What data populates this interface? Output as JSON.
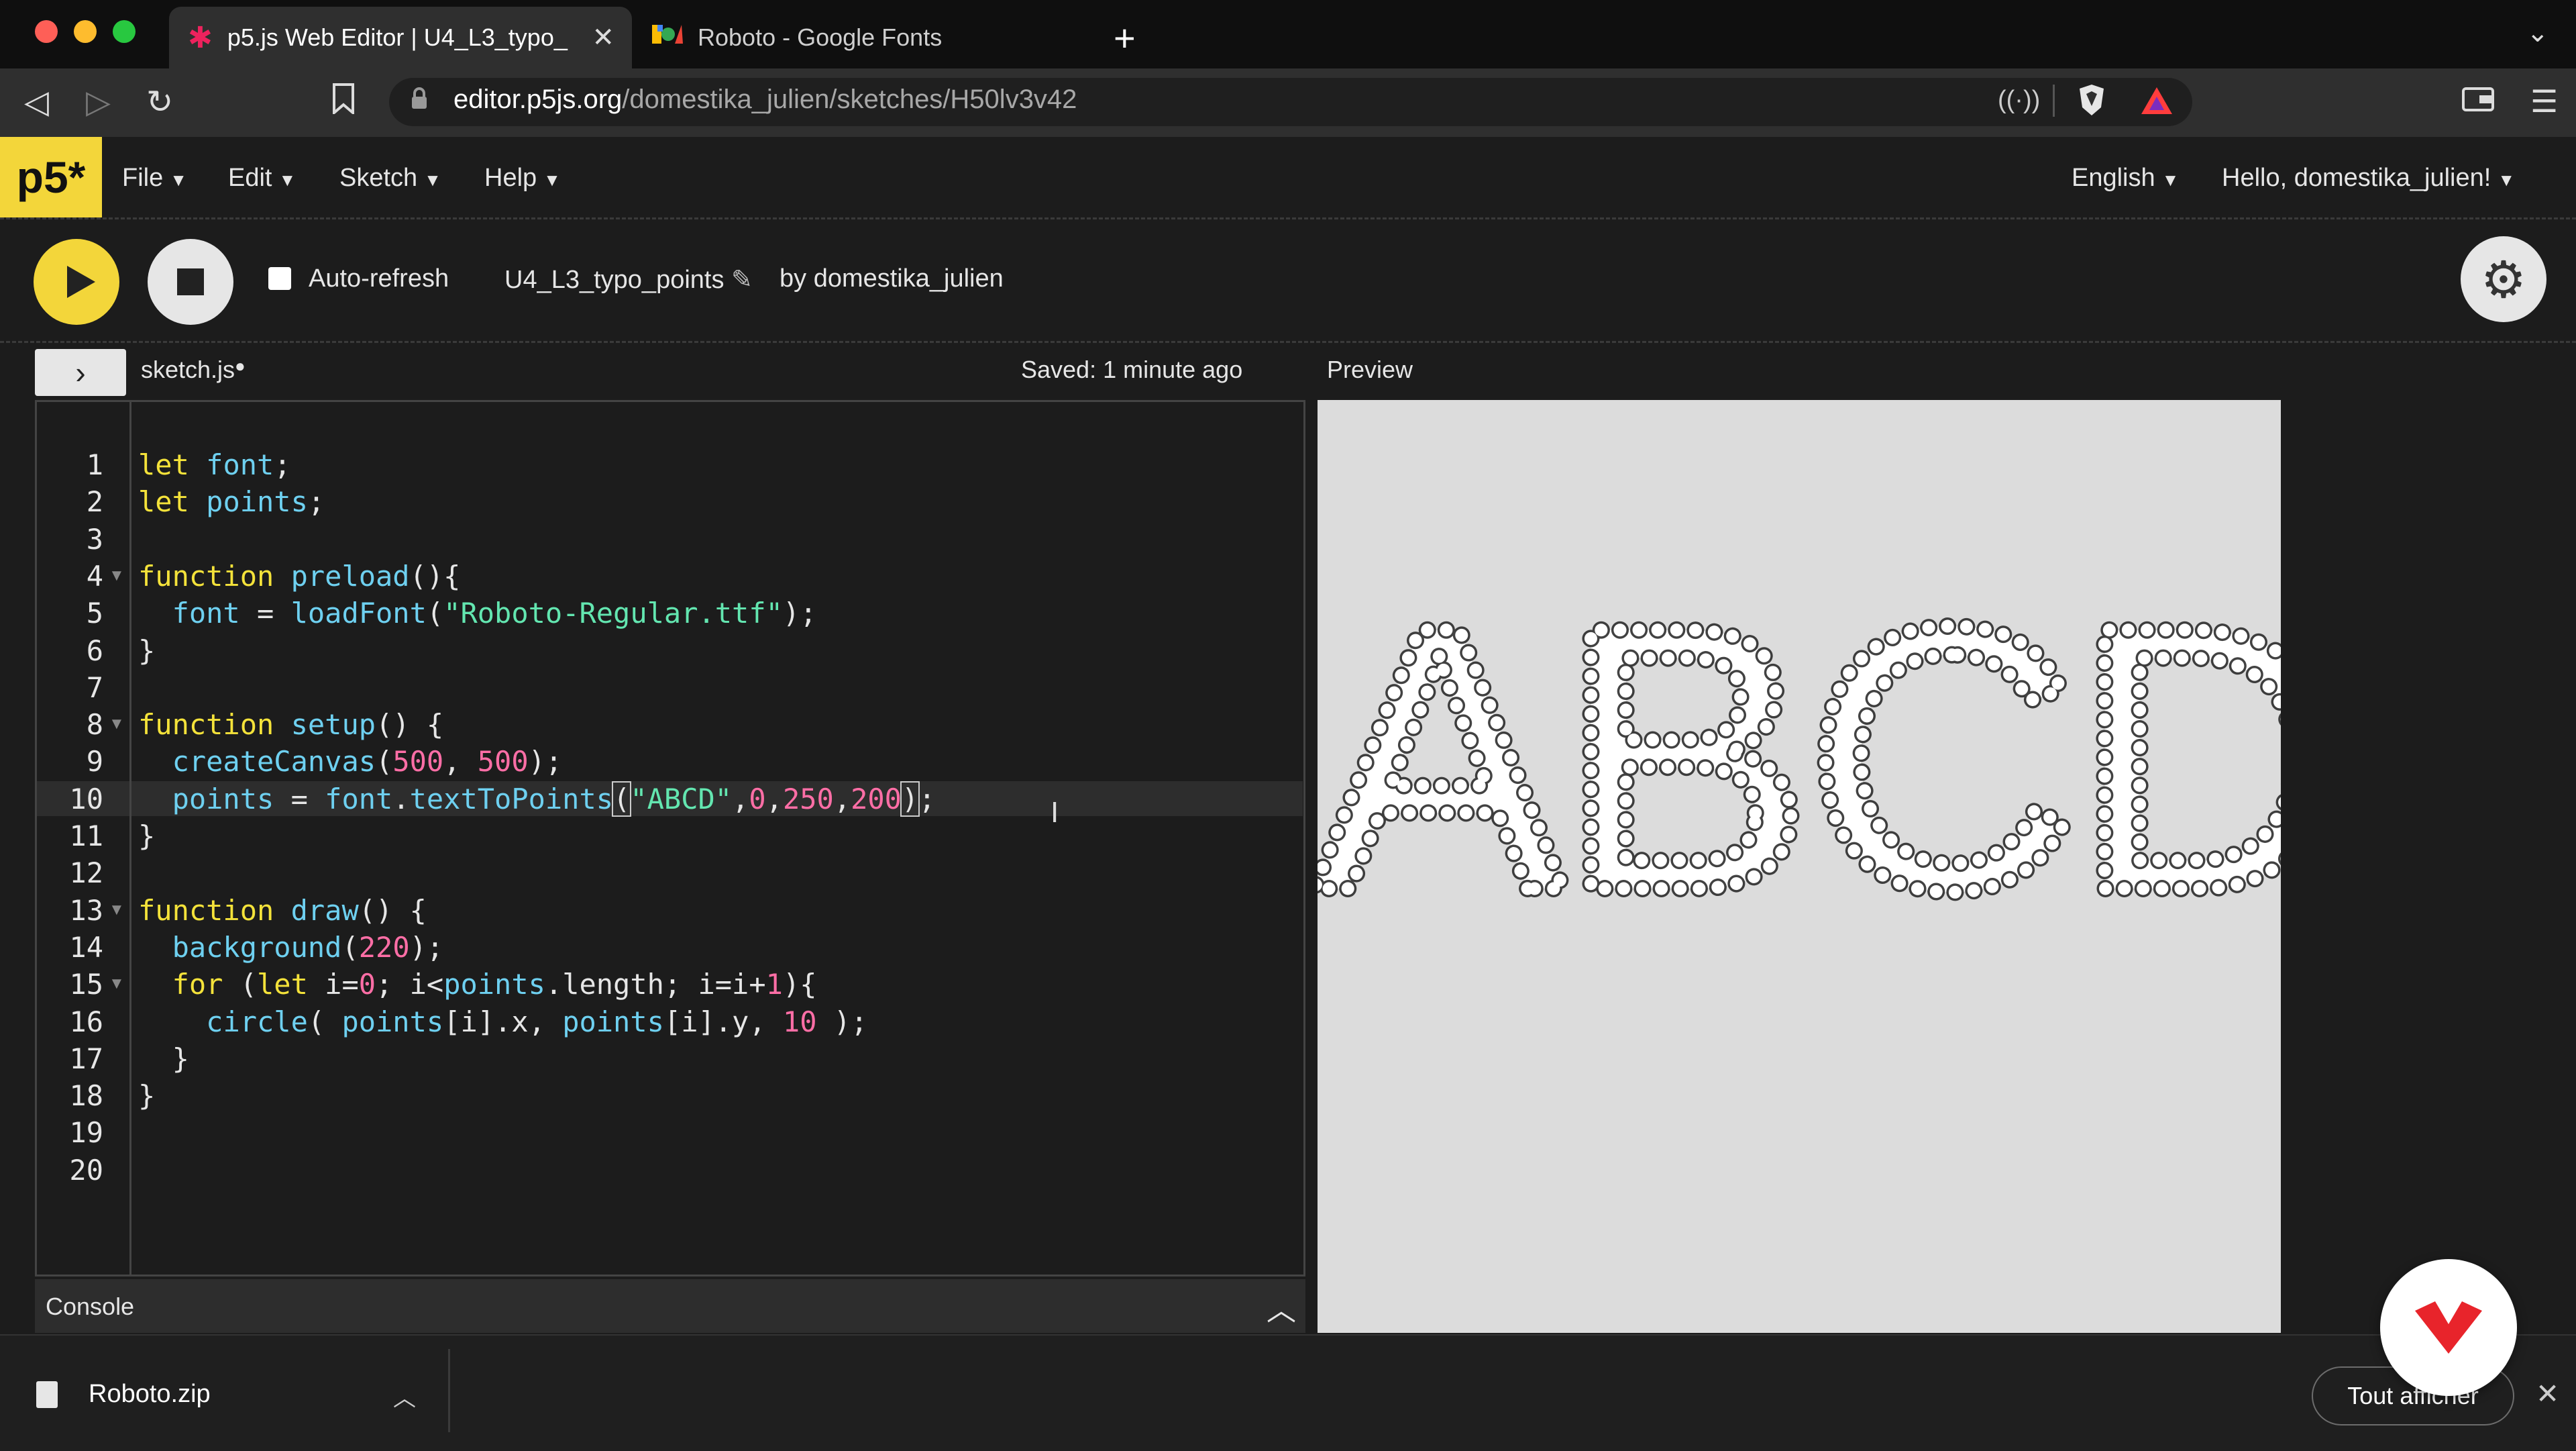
{
  "browser": {
    "tabs": [
      {
        "title": "p5.js Web Editor | U4_L3_typo_",
        "favicon": "p5-asterisk-icon"
      },
      {
        "title": "Roboto - Google Fonts",
        "favicon": "google-fonts-icon"
      }
    ],
    "url_domain": "editor.p5js.org",
    "url_path": "/domestika_julien/sketches/H50lv3v42"
  },
  "p5": {
    "logo": "p5*",
    "menu": [
      "File",
      "Edit",
      "Sketch",
      "Help"
    ],
    "language": "English",
    "user": "Hello, domestika_julien!",
    "auto_refresh_label": "Auto-refresh",
    "sketch_name": "U4_L3_typo_points",
    "author": "by domestika_julien",
    "file_tab": "sketch.js",
    "saved_status": "Saved: 1 minute ago",
    "preview_label": "Preview",
    "console_label": "Console"
  },
  "code_lines": [
    "let font;",
    "let points;",
    "",
    "function preload(){",
    "  font = loadFont(\"Roboto-Regular.ttf\");",
    "}",
    "",
    "function setup() {",
    "  createCanvas(500, 500);",
    "  points = font.textToPoints(\"ABCD\",0,250,200);",
    "}",
    "",
    "function draw() {",
    "  background(220);",
    "  for (let i=0; i<points.length; i=i+1){",
    "    circle( points[i].x, points[i].y, 10 );",
    "  }",
    "}",
    "",
    ""
  ],
  "preview_text": "ABCD",
  "downloads": {
    "file": "Roboto.zip",
    "show_all": "Tout afficher"
  },
  "colors": {
    "p5_yellow": "#f3d63a",
    "editor_bg": "#1c1c1c",
    "preview_bg": "#dcdcdc",
    "domestika_red": "#e8242b"
  }
}
